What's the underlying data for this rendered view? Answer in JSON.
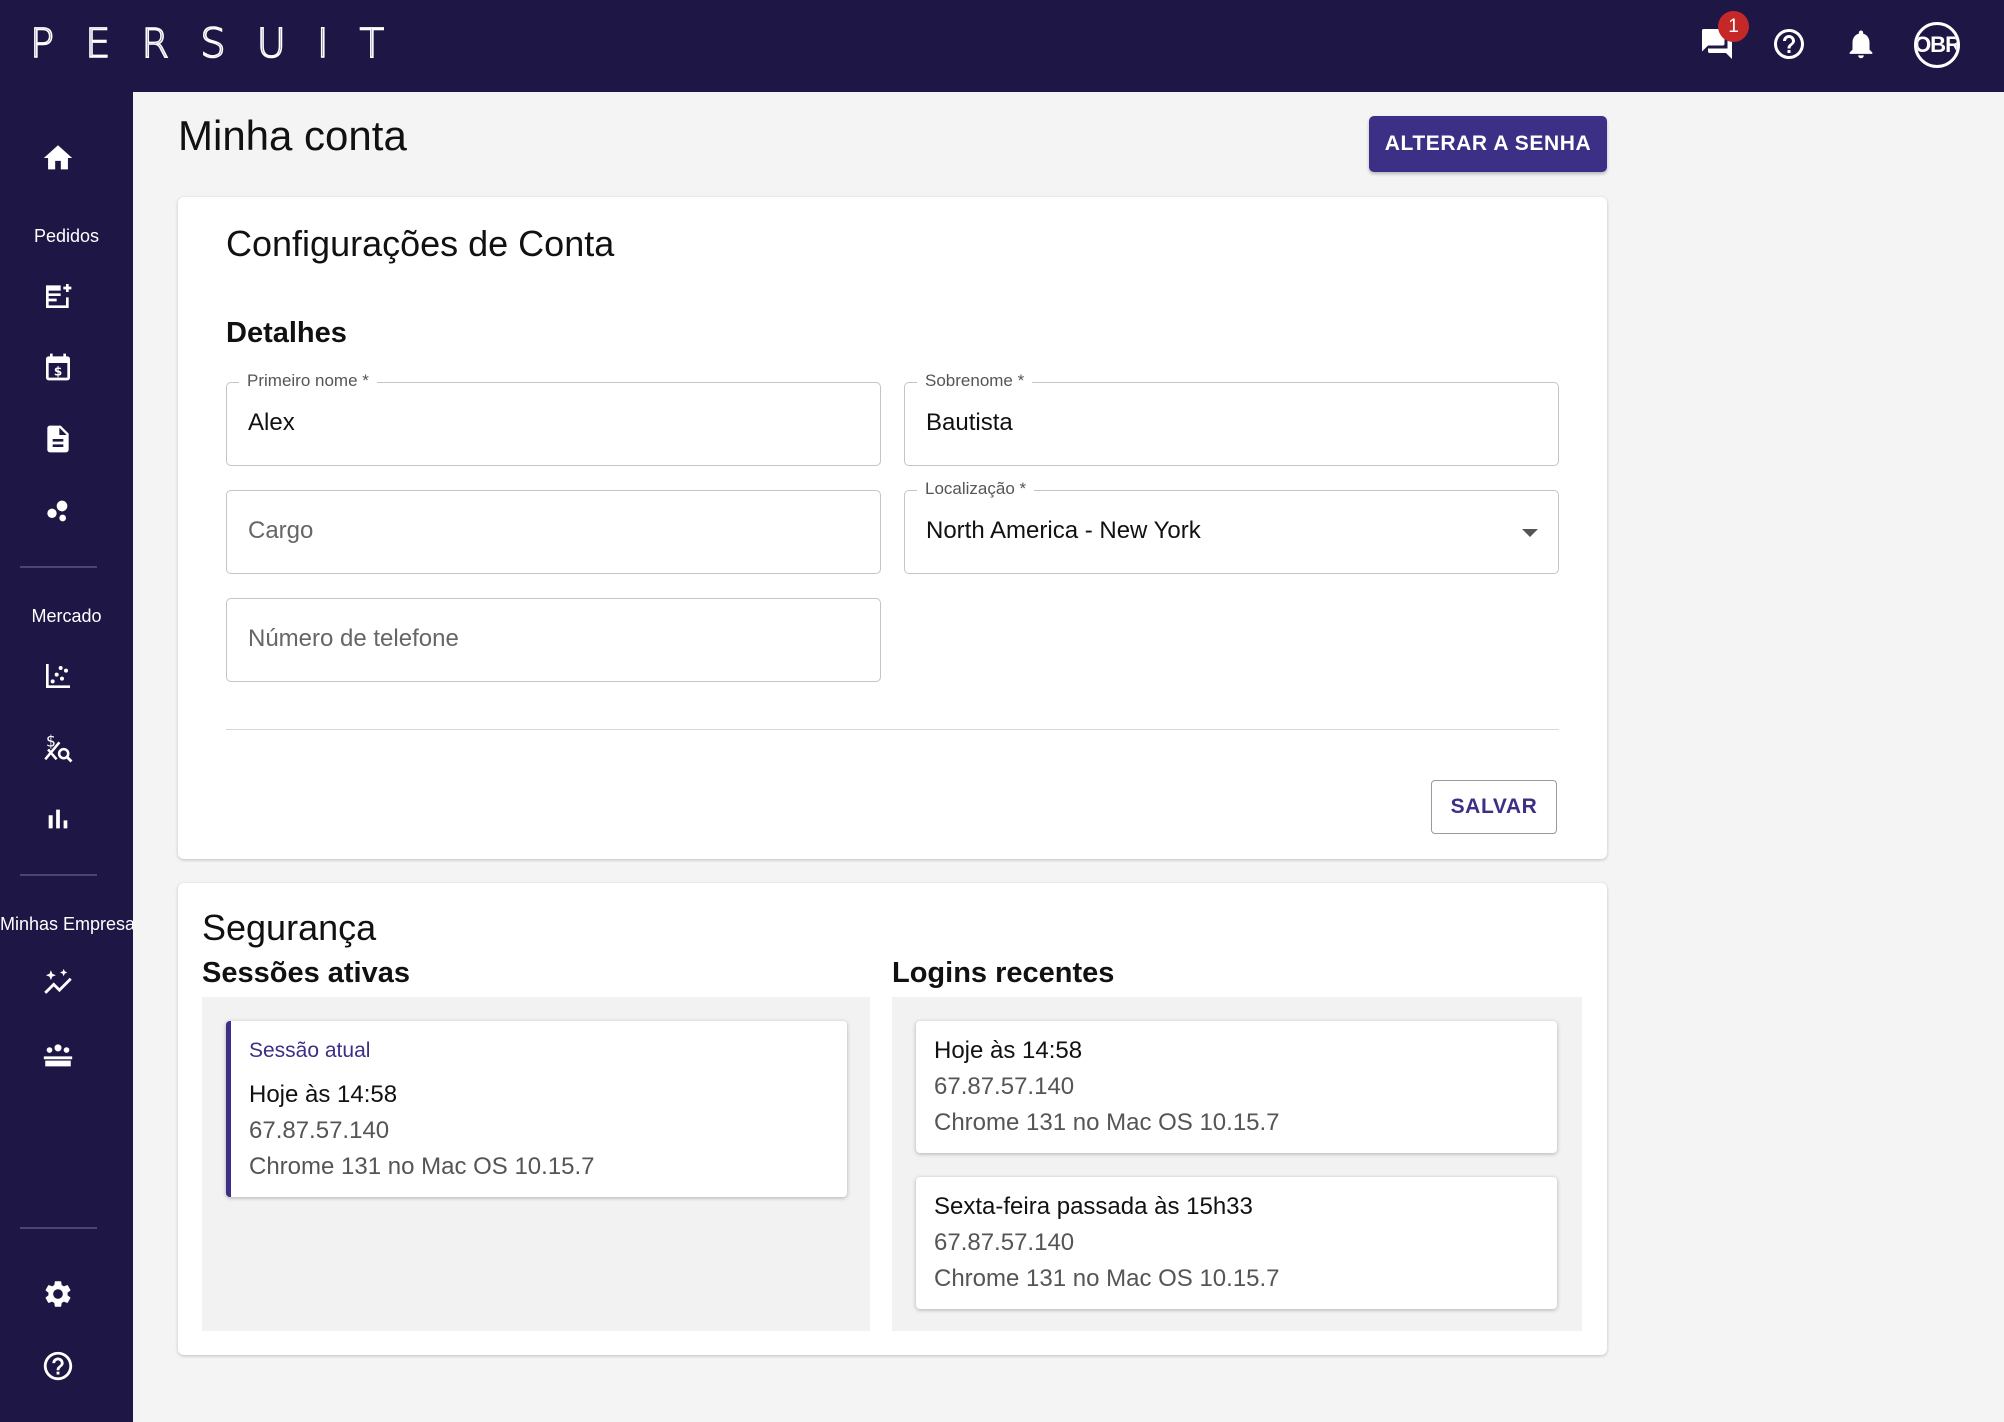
{
  "app": {
    "logo_letters": [
      "P",
      "E",
      "R",
      "S",
      "U",
      "I",
      "T"
    ],
    "notification_count": "1",
    "avatar_initials": "OBR"
  },
  "sidebar": {
    "section_labels": {
      "orders": "Pedidos",
      "market": "Mercado",
      "companies": "Minhas Empresas"
    },
    "icons": [
      "home-icon",
      "new-request-icon",
      "calendar-dollar-icon",
      "document-icon",
      "bubbles-icon",
      "scatter-chart-icon",
      "dollar-search-icon",
      "bar-chart-icon",
      "sparkle-trend-icon",
      "group-icon",
      "settings-icon",
      "help-icon"
    ]
  },
  "page": {
    "title": "Minha conta",
    "change_password_label": "ALTERAR A SENHA"
  },
  "account": {
    "title": "Configurações de Conta",
    "details_heading": "Detalhes",
    "first_name": {
      "label": "Primeiro nome  *",
      "value": "Alex"
    },
    "last_name": {
      "label": "Sobrenome  *",
      "value": "Bautista"
    },
    "job_title": {
      "placeholder": "Cargo",
      "value": ""
    },
    "location": {
      "label": "Localização  *",
      "value": "North America - New York"
    },
    "phone": {
      "placeholder": "Número de telefone",
      "value": ""
    },
    "save_label": "SALVAR"
  },
  "security": {
    "title": "Segurança",
    "active_sessions_heading": "Sessões ativas",
    "recent_logins_heading": "Logins recentes",
    "current_session": {
      "tag": "Sessão atual",
      "time": "Hoje às 14:58",
      "ip": "67.87.57.140",
      "browser": "Chrome 131 no Mac OS 10.15.7"
    },
    "recent_logins": [
      {
        "time": "Hoje às 14:58",
        "ip": "67.87.57.140",
        "browser": "Chrome 131 no Mac OS 10.15.7"
      },
      {
        "time": "Sexta-feira passada às 15h33",
        "ip": "67.87.57.140",
        "browser": "Chrome 131 no Mac OS 10.15.7"
      }
    ]
  },
  "colors": {
    "nav_background": "#1e1745",
    "accent": "#3b2f86",
    "badge": "#c62828",
    "page_background": "#f4f4f4"
  }
}
